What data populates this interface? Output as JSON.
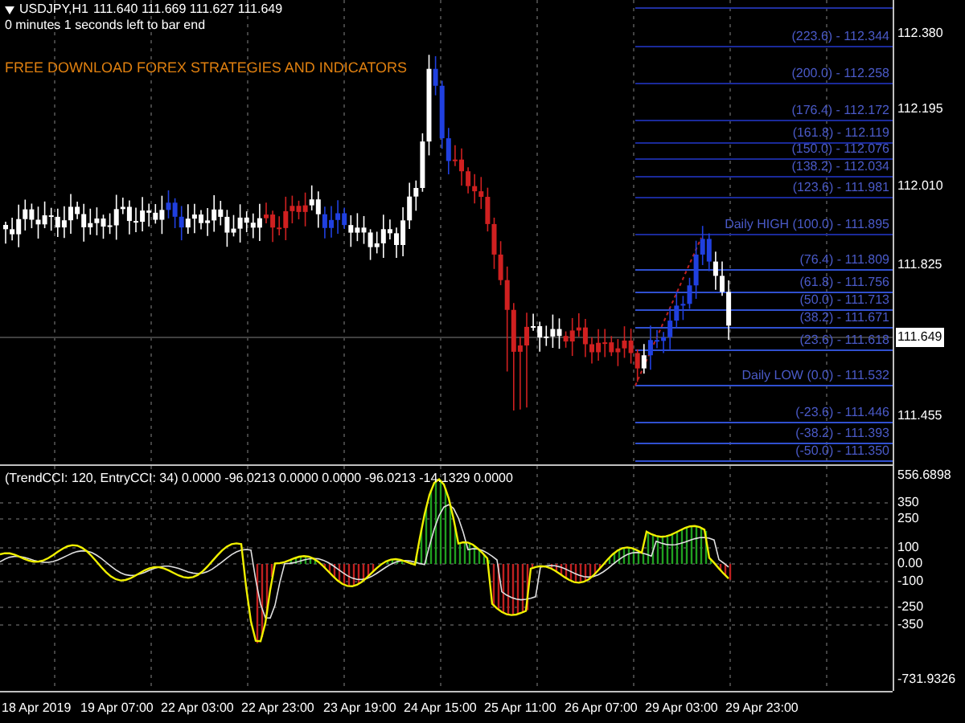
{
  "header": {
    "symbol": "USDJPY,H1",
    "ohlc": "111.640 111.669 111.627 111.649",
    "timer": "0 minutes 1 seconds left to bar end",
    "promo": "FREE DOWNLOAD FOREX STRATEGIES AND INDICATORS"
  },
  "fib_levels": [
    {
      "label": "(223.6) - 112.344"
    },
    {
      "label": "(200.0) - 112.258"
    },
    {
      "label": "(176.4) - 112.172"
    },
    {
      "label": "(161.8) - 112.119"
    },
    {
      "label": "(150.0) - 112.076"
    },
    {
      "label": "(138.2) - 112.034"
    },
    {
      "label": "(123.6) - 111.981"
    },
    {
      "label": "Daily HIGH (100.0) - 111.895"
    },
    {
      "label": "(76.4) - 111.809"
    },
    {
      "label": "(61.8) - 111.756"
    },
    {
      "label": "(50.0) - 111.713"
    },
    {
      "label": "(38.2) - 111.671"
    },
    {
      "label": "(23.6) - 111.618"
    },
    {
      "label": "Daily LOW (0.0) - 111.532"
    },
    {
      "label": "(-23.6) - 111.446"
    },
    {
      "label": "(-38.2) - 111.393"
    },
    {
      "label": "(-50.0) - 111.350"
    }
  ],
  "price_axis": [
    {
      "label": "112.380",
      "kind": "tick"
    },
    {
      "label": "112.195",
      "kind": "tick"
    },
    {
      "label": "112.010",
      "kind": "tick"
    },
    {
      "label": "111.825",
      "kind": "tick"
    },
    {
      "label": "111.649",
      "kind": "current"
    },
    {
      "label": "111.455",
      "kind": "tick"
    }
  ],
  "indicator": {
    "label": "(TrendCCI: 120, EntryCCI: 34)  0.0000 -96.0213 0.0000 0.0000 -96.0213 -14.1329 0.0000",
    "axis": [
      {
        "label": "556.6898"
      },
      {
        "label": "350"
      },
      {
        "label": "250"
      },
      {
        "label": "100"
      },
      {
        "label": "0.00"
      },
      {
        "label": "-100"
      },
      {
        "label": "-250"
      },
      {
        "label": "-350"
      },
      {
        "label": "-731.9326"
      }
    ]
  },
  "time_axis": [
    {
      "label": "18 Apr 2019"
    },
    {
      "label": "19 Apr 07:00"
    },
    {
      "label": "22 Apr 03:00"
    },
    {
      "label": "22 Apr 23:00"
    },
    {
      "label": "23 Apr 19:00"
    },
    {
      "label": "24 Apr 15:00"
    },
    {
      "label": "25 Apr 11:00"
    },
    {
      "label": "26 Apr 07:00"
    },
    {
      "label": "29 Apr 03:00"
    },
    {
      "label": "29 Apr 23:00"
    }
  ]
}
